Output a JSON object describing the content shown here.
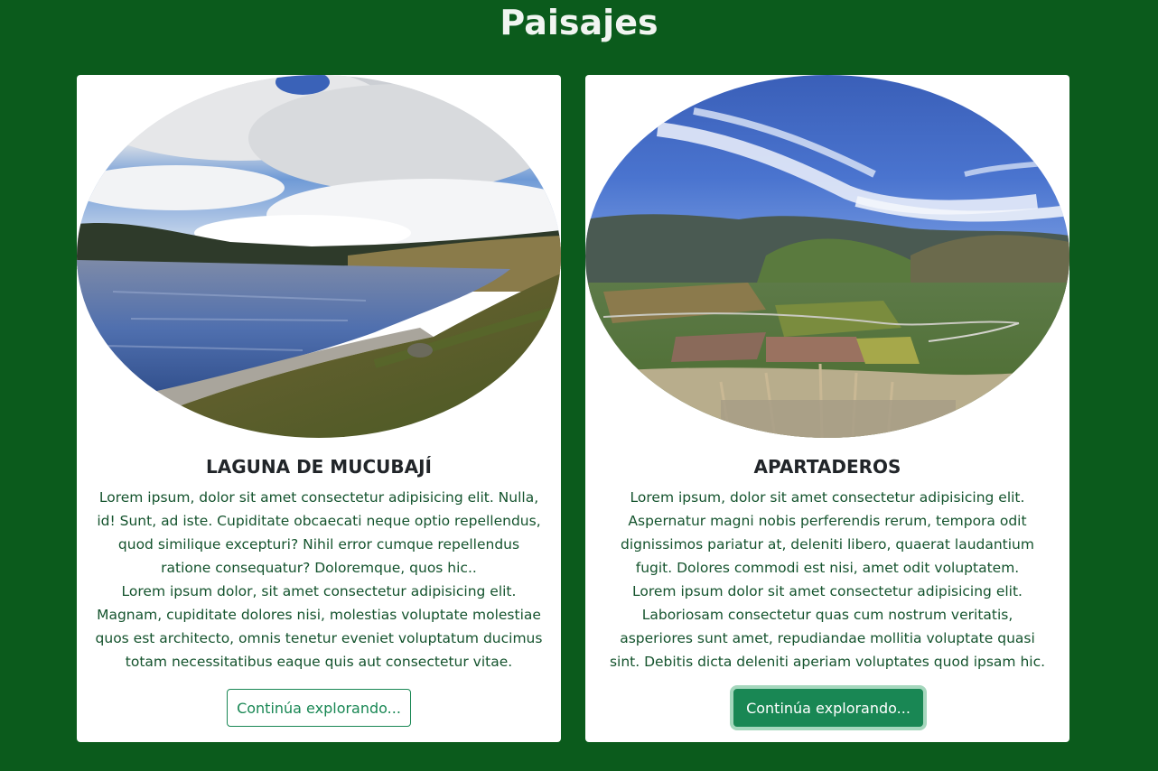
{
  "page": {
    "title": "Paisajes"
  },
  "colors": {
    "background": "#0b5b1c",
    "card_background": "#ffffff",
    "title_text": "#f1f5f1",
    "body_text": "#14532d",
    "accent": "#198754"
  },
  "cards": [
    {
      "image_icon": "lake-landscape-photo",
      "title": "LAGUNA DE MUCUBAJÍ",
      "paragraphs": [
        "Lorem ipsum, dolor sit amet consectetur adipisicing elit. Nulla, id! Sunt, ad iste. Cupiditate obcaecati neque optio repellendus, quod similique excepturi? Nihil error cumque repellendus ratione consequatur? Doloremque, quos hic..",
        "Lorem ipsum dolor, sit amet consectetur adipisicing elit. Magnam, cupiditate dolores nisi, molestias voluptate molestiae quos est architecto, omnis tenetur eveniet voluptatum ducimus totam necessitatibus eaque quis aut consectetur vitae."
      ],
      "button_label": "Continúa explorando..."
    },
    {
      "image_icon": "mountain-valley-photo",
      "title": "APARTADEROS",
      "paragraphs": [
        "Lorem ipsum, dolor sit amet consectetur adipisicing elit. Aspernatur magni nobis perferendis rerum, tempora odit dignissimos pariatur at, deleniti libero, quaerat laudantium fugit. Dolores commodi est nisi, amet odit voluptatem.",
        "Lorem ipsum dolor sit amet consectetur adipisicing elit. Laboriosam consectetur quas cum nostrum veritatis, asperiores sunt amet, repudiandae mollitia voluptate quasi sint. Debitis dicta deleniti aperiam voluptates quod ipsam hic."
      ],
      "button_label": "Continúa explorando..."
    }
  ]
}
